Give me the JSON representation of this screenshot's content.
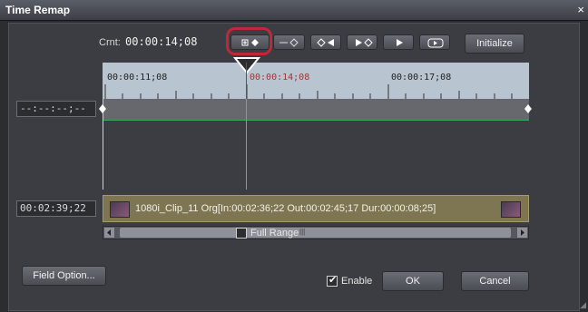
{
  "window": {
    "title": "Time Remap",
    "close_glyph": "×"
  },
  "current": {
    "label": "Crnt:",
    "value": "00:00:14;08"
  },
  "toolbar": {
    "buttons": [
      {
        "name": "add-keyframe-button",
        "icon": "add-keyframe-icon",
        "glyph": "+◆"
      },
      {
        "name": "delete-keyframe-button",
        "icon": "delete-keyframe-icon",
        "glyph": "−◇"
      },
      {
        "name": "prev-keyframe-button",
        "icon": "prev-keyframe-icon",
        "glyph": "◇◀"
      },
      {
        "name": "next-keyframe-button",
        "icon": "next-keyframe-icon",
        "glyph": "▶◇"
      },
      {
        "name": "play-button",
        "icon": "play-icon",
        "glyph": "▶"
      },
      {
        "name": "loop-play-button",
        "icon": "loop-play-icon",
        "glyph": "⟲"
      }
    ],
    "initialize_label": "Initialize"
  },
  "ruler": {
    "labels": [
      "00:00:11;08",
      "00:00:14;08",
      "00:00:17;08"
    ]
  },
  "left_timecodes": {
    "top": "--:--:--;--",
    "bottom": "00:02:39;22"
  },
  "clip": {
    "text": "1080i_Clip_11  Org[In:00:02:36;22 Out:00:02:45;17 Dur:00:00:08;25]"
  },
  "options": {
    "full_range_label": "Full Range",
    "full_range_checked": false,
    "enable_label": "Enable",
    "enable_checked": true
  },
  "buttons": {
    "field_option": "Field Option...",
    "ok": "OK",
    "cancel": "Cancel"
  },
  "colors": {
    "accent_highlight": "#c0283a",
    "cursor": "#b03030",
    "graph_line": "#3ea85a"
  }
}
